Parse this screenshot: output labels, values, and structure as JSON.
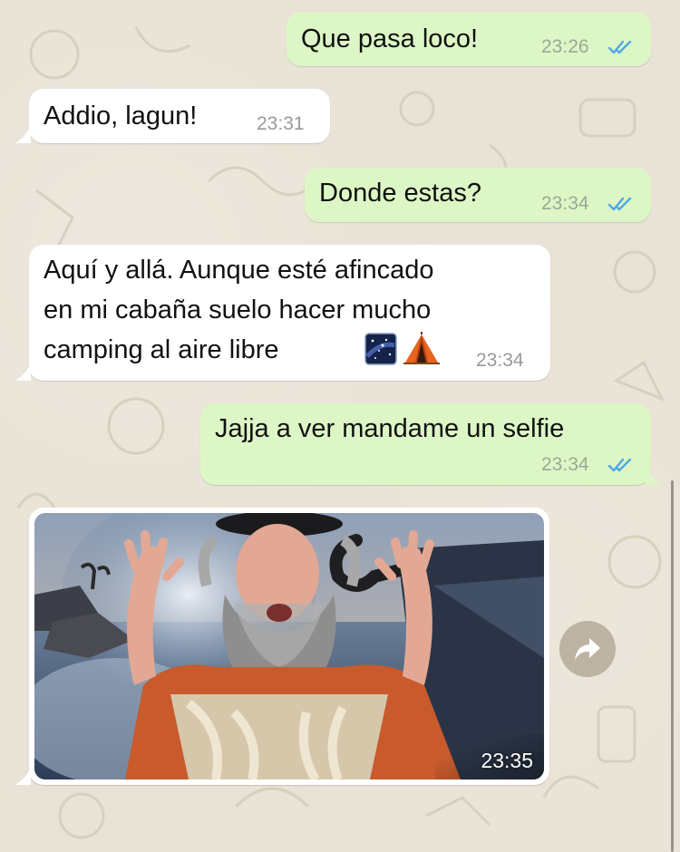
{
  "messages": [
    {
      "id": "m1",
      "direction": "outgoing",
      "text": "Que pasa loco!",
      "time": "23:26",
      "status": "read"
    },
    {
      "id": "m2",
      "direction": "incoming",
      "text": "Addio, lagun!",
      "time": "23:31"
    },
    {
      "id": "m3",
      "direction": "outgoing",
      "text": "Donde estas?",
      "time": "23:34",
      "status": "read"
    },
    {
      "id": "m4",
      "direction": "incoming",
      "lines": [
        "Aquí y allá. Aunque esté afincado",
        "en mi cabaña suelo hacer mucho",
        "camping al aire libre"
      ],
      "emoji": [
        "night-sky-emoji",
        "tent-emoji"
      ],
      "time": "23:34"
    },
    {
      "id": "m5",
      "direction": "outgoing",
      "text": "Jajja a ver mandame un selfie",
      "time": "23:34",
      "status": "read"
    },
    {
      "id": "m6",
      "direction": "incoming",
      "type": "image",
      "time": "23:35"
    }
  ],
  "icons": {
    "read_ticks": "double-check-icon",
    "forward": "forward-arrow-icon"
  },
  "colors": {
    "outgoing_bubble": "#dcf7c5",
    "incoming_bubble": "#ffffff",
    "ticks": "#4fa8e6",
    "wallpaper": "#e9e2d6"
  }
}
